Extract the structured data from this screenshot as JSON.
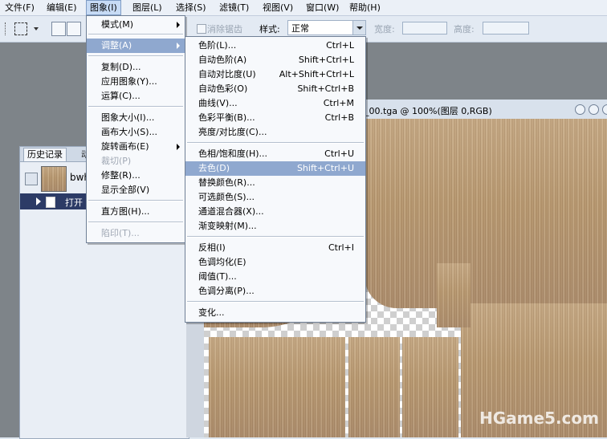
{
  "menubar": {
    "items": [
      {
        "label": "文件(F)"
      },
      {
        "label": "编辑(E)"
      },
      {
        "label": "图象(I)"
      },
      {
        "label": "图层(L)"
      },
      {
        "label": "选择(S)"
      },
      {
        "label": "滤镜(T)"
      },
      {
        "label": "视图(V)"
      },
      {
        "label": "窗口(W)"
      },
      {
        "label": "帮助(H)"
      }
    ]
  },
  "options": {
    "antialias_label": "消除锯齿",
    "style_label": "样式:",
    "style_value": "正常",
    "width_label": "宽度:",
    "height_label": "高度:"
  },
  "document": {
    "title": "_00.tga @ 100%(图层 0,RGB)"
  },
  "history": {
    "tab_history": "历史记录",
    "tab_actions": "动",
    "snapshot_label": "bwh",
    "step_label": "打开"
  },
  "image_menu": {
    "items": [
      {
        "label": "模式(M)",
        "submenu": true
      },
      {
        "label": "调整(A)",
        "submenu": true,
        "selected": true
      },
      {
        "label": "复制(D)..."
      },
      {
        "label": "应用图象(Y)..."
      },
      {
        "label": "运算(C)..."
      },
      {
        "label": "图象大小(I)..."
      },
      {
        "label": "画布大小(S)..."
      },
      {
        "label": "旋转画布(E)",
        "submenu": true
      },
      {
        "label": "裁切(P)",
        "disabled": true
      },
      {
        "label": "修整(R)..."
      },
      {
        "label": "显示全部(V)"
      },
      {
        "label": "直方图(H)..."
      },
      {
        "label": "陷印(T)...",
        "disabled": true
      }
    ]
  },
  "adjust_menu": {
    "items": [
      {
        "label": "色阶(L)...",
        "shortcut": "Ctrl+L"
      },
      {
        "label": "自动色阶(A)",
        "shortcut": "Shift+Ctrl+L"
      },
      {
        "label": "自动对比度(U)",
        "shortcut": "Alt+Shift+Ctrl+L"
      },
      {
        "label": "自动色彩(O)",
        "shortcut": "Shift+Ctrl+B"
      },
      {
        "label": "曲线(V)...",
        "shortcut": "Ctrl+M"
      },
      {
        "label": "色彩平衡(B)...",
        "shortcut": "Ctrl+B"
      },
      {
        "label": "亮度/对比度(C)...",
        "shortcut": ""
      },
      {
        "label": "色相/饱和度(H)...",
        "shortcut": "Ctrl+U"
      },
      {
        "label": "去色(D)",
        "shortcut": "Shift+Ctrl+U",
        "selected": true
      },
      {
        "label": "替换颜色(R)...",
        "shortcut": ""
      },
      {
        "label": "可选颜色(S)...",
        "shortcut": ""
      },
      {
        "label": "通道混合器(X)...",
        "shortcut": ""
      },
      {
        "label": "渐变映射(M)...",
        "shortcut": ""
      },
      {
        "label": "反相(I)",
        "shortcut": "Ctrl+I"
      },
      {
        "label": "色调均化(E)",
        "shortcut": ""
      },
      {
        "label": "阈值(T)...",
        "shortcut": ""
      },
      {
        "label": "色调分离(P)...",
        "shortcut": ""
      },
      {
        "label": "变化...",
        "shortcut": ""
      }
    ]
  },
  "watermark": "HGame5.com",
  "colors": {
    "menu_highlight": "#8fa8cf",
    "menubar_bg": "#ebf0f7",
    "history_selected": "#2c3b66"
  }
}
